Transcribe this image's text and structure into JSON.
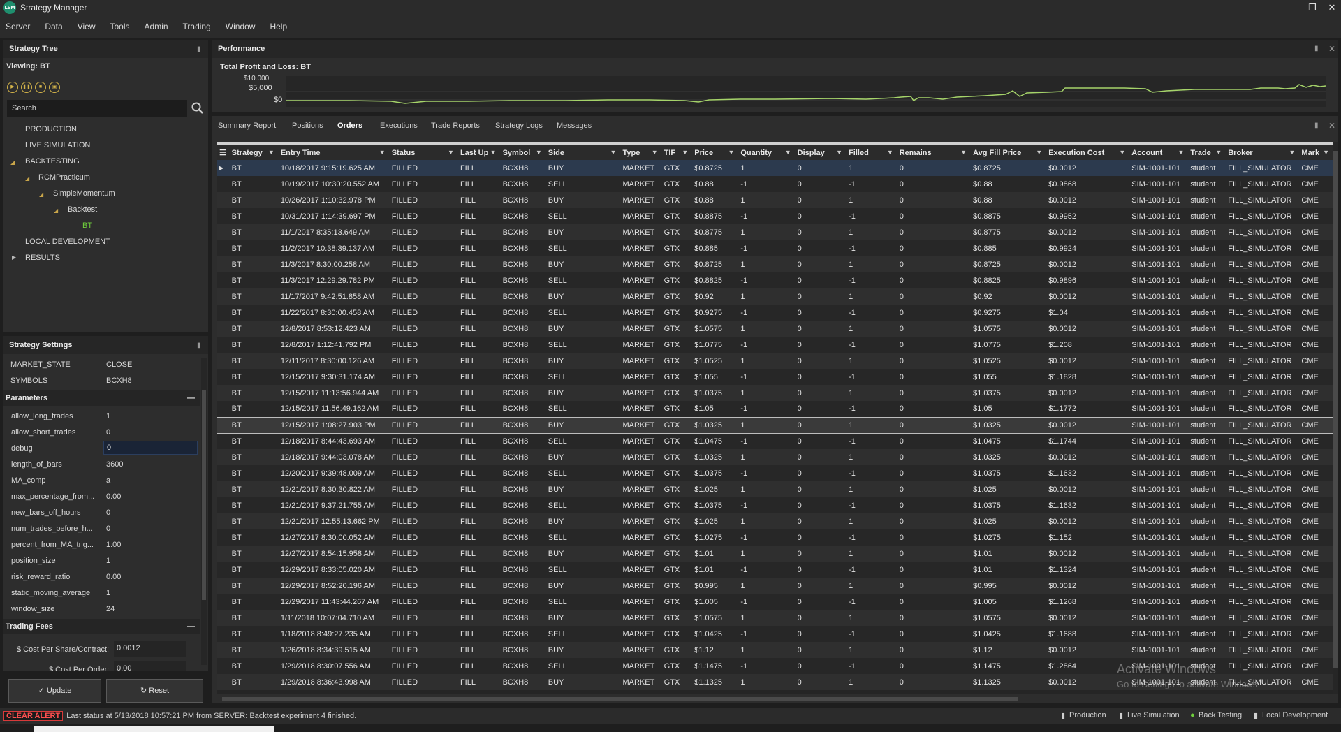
{
  "window": {
    "title": "Strategy Manager",
    "logo": "LSM"
  },
  "menu": [
    "Server",
    "Data",
    "View",
    "Tools",
    "Admin",
    "Trading",
    "Window",
    "Help"
  ],
  "strategy_tree": {
    "title": "Strategy Tree",
    "viewing": "Viewing: BT",
    "search_placeholder": "Search",
    "items": [
      {
        "label": "PRODUCTION"
      },
      {
        "label": "LIVE SIMULATION"
      },
      {
        "label": "BACKTESTING"
      },
      {
        "label": "RCMPracticum"
      },
      {
        "label": "SimpleMomentum"
      },
      {
        "label": "Backtest"
      },
      {
        "label": "BT"
      },
      {
        "label": "LOCAL DEVELOPMENT"
      },
      {
        "label": "RESULTS"
      }
    ]
  },
  "strategy_settings": {
    "title": "Strategy Settings",
    "top_rows": [
      {
        "label": "MARKET_STATE",
        "value": "CLOSE"
      },
      {
        "label": "SYMBOLS",
        "value": "BCXH8"
      }
    ],
    "parameters_title": "Parameters",
    "parameters": [
      {
        "label": "allow_long_trades",
        "value": "1"
      },
      {
        "label": "allow_short_trades",
        "value": "0"
      },
      {
        "label": "debug",
        "value": "0"
      },
      {
        "label": "length_of_bars",
        "value": "3600"
      },
      {
        "label": "MA_comp",
        "value": "a"
      },
      {
        "label": "max_percentage_from...",
        "value": "0.00"
      },
      {
        "label": "new_bars_off_hours",
        "value": "0"
      },
      {
        "label": "num_trades_before_h...",
        "value": "0"
      },
      {
        "label": "percent_from_MA_trig...",
        "value": "1.00"
      },
      {
        "label": "position_size",
        "value": "1"
      },
      {
        "label": "risk_reward_ratio",
        "value": "0.00"
      },
      {
        "label": "static_moving_average",
        "value": "1"
      },
      {
        "label": "window_size",
        "value": "24"
      }
    ],
    "fees_title": "Trading Fees",
    "cost_share_label": "$ Cost Per Share/Contract:",
    "cost_share_value": "0.0012",
    "cost_order_label": "$ Cost Per Order:",
    "cost_order_value": "0.00",
    "update_label": "Update",
    "reset_label": "Reset"
  },
  "performance": {
    "title": "Performance",
    "subtitle": "Total Profit and Loss: BT",
    "y_ticks": [
      "$10,000",
      "$5,000",
      "$0"
    ],
    "line_color": "#a6d46a"
  },
  "orders_panel": {
    "tabs": [
      "Summary Report",
      "Positions",
      "Orders",
      "Executions",
      "Trade Reports",
      "Strategy Logs",
      "Messages"
    ],
    "active_tab": "Orders",
    "columns": [
      "Strategy",
      "Entry Time",
      "Status",
      "Last Up",
      "Symbol",
      "Side",
      "Type",
      "TIF",
      "Price",
      "Quantity",
      "Display",
      "Filled",
      "Remains",
      "Avg Fill Price",
      "Execution Cost",
      "Account",
      "Trade",
      "Broker",
      "Mark"
    ],
    "rows": [
      [
        "BT",
        "10/18/2017 9:15:19.625 AM",
        "FILLED",
        "FILL",
        "BCXH8",
        "BUY",
        "MARKET",
        "GTX",
        "$0.8725",
        "1",
        "0",
        "1",
        "0",
        "$0.8725",
        "$0.0012",
        "SIM-1001-101",
        "student",
        "FILL_SIMULATOR",
        "CME"
      ],
      [
        "BT",
        "10/19/2017 10:30:20.552 AM",
        "FILLED",
        "FILL",
        "BCXH8",
        "SELL",
        "MARKET",
        "GTX",
        "$0.88",
        "-1",
        "0",
        "-1",
        "0",
        "$0.88",
        "$0.9868",
        "SIM-1001-101",
        "student",
        "FILL_SIMULATOR",
        "CME"
      ],
      [
        "BT",
        "10/26/2017 1:10:32.978 PM",
        "FILLED",
        "FILL",
        "BCXH8",
        "BUY",
        "MARKET",
        "GTX",
        "$0.88",
        "1",
        "0",
        "1",
        "0",
        "$0.88",
        "$0.0012",
        "SIM-1001-101",
        "student",
        "FILL_SIMULATOR",
        "CME"
      ],
      [
        "BT",
        "10/31/2017 1:14:39.697 PM",
        "FILLED",
        "FILL",
        "BCXH8",
        "SELL",
        "MARKET",
        "GTX",
        "$0.8875",
        "-1",
        "0",
        "-1",
        "0",
        "$0.8875",
        "$0.9952",
        "SIM-1001-101",
        "student",
        "FILL_SIMULATOR",
        "CME"
      ],
      [
        "BT",
        "11/1/2017 8:35:13.649 AM",
        "FILLED",
        "FILL",
        "BCXH8",
        "BUY",
        "MARKET",
        "GTX",
        "$0.8775",
        "1",
        "0",
        "1",
        "0",
        "$0.8775",
        "$0.0012",
        "SIM-1001-101",
        "student",
        "FILL_SIMULATOR",
        "CME"
      ],
      [
        "BT",
        "11/2/2017 10:38:39.137 AM",
        "FILLED",
        "FILL",
        "BCXH8",
        "SELL",
        "MARKET",
        "GTX",
        "$0.885",
        "-1",
        "0",
        "-1",
        "0",
        "$0.885",
        "$0.9924",
        "SIM-1001-101",
        "student",
        "FILL_SIMULATOR",
        "CME"
      ],
      [
        "BT",
        "11/3/2017 8:30:00.258 AM",
        "FILLED",
        "FILL",
        "BCXH8",
        "BUY",
        "MARKET",
        "GTX",
        "$0.8725",
        "1",
        "0",
        "1",
        "0",
        "$0.8725",
        "$0.0012",
        "SIM-1001-101",
        "student",
        "FILL_SIMULATOR",
        "CME"
      ],
      [
        "BT",
        "11/3/2017 12:29:29.782 PM",
        "FILLED",
        "FILL",
        "BCXH8",
        "SELL",
        "MARKET",
        "GTX",
        "$0.8825",
        "-1",
        "0",
        "-1",
        "0",
        "$0.8825",
        "$0.9896",
        "SIM-1001-101",
        "student",
        "FILL_SIMULATOR",
        "CME"
      ],
      [
        "BT",
        "11/17/2017 9:42:51.858 AM",
        "FILLED",
        "FILL",
        "BCXH8",
        "BUY",
        "MARKET",
        "GTX",
        "$0.92",
        "1",
        "0",
        "1",
        "0",
        "$0.92",
        "$0.0012",
        "SIM-1001-101",
        "student",
        "FILL_SIMULATOR",
        "CME"
      ],
      [
        "BT",
        "11/22/2017 8:30:00.458 AM",
        "FILLED",
        "FILL",
        "BCXH8",
        "SELL",
        "MARKET",
        "GTX",
        "$0.9275",
        "-1",
        "0",
        "-1",
        "0",
        "$0.9275",
        "$1.04",
        "SIM-1001-101",
        "student",
        "FILL_SIMULATOR",
        "CME"
      ],
      [
        "BT",
        "12/8/2017 8:53:12.423 AM",
        "FILLED",
        "FILL",
        "BCXH8",
        "BUY",
        "MARKET",
        "GTX",
        "$1.0575",
        "1",
        "0",
        "1",
        "0",
        "$1.0575",
        "$0.0012",
        "SIM-1001-101",
        "student",
        "FILL_SIMULATOR",
        "CME"
      ],
      [
        "BT",
        "12/8/2017 1:12:41.792 PM",
        "FILLED",
        "FILL",
        "BCXH8",
        "SELL",
        "MARKET",
        "GTX",
        "$1.0775",
        "-1",
        "0",
        "-1",
        "0",
        "$1.0775",
        "$1.208",
        "SIM-1001-101",
        "student",
        "FILL_SIMULATOR",
        "CME"
      ],
      [
        "BT",
        "12/11/2017 8:30:00.126 AM",
        "FILLED",
        "FILL",
        "BCXH8",
        "BUY",
        "MARKET",
        "GTX",
        "$1.0525",
        "1",
        "0",
        "1",
        "0",
        "$1.0525",
        "$0.0012",
        "SIM-1001-101",
        "student",
        "FILL_SIMULATOR",
        "CME"
      ],
      [
        "BT",
        "12/15/2017 9:30:31.174 AM",
        "FILLED",
        "FILL",
        "BCXH8",
        "SELL",
        "MARKET",
        "GTX",
        "$1.055",
        "-1",
        "0",
        "-1",
        "0",
        "$1.055",
        "$1.1828",
        "SIM-1001-101",
        "student",
        "FILL_SIMULATOR",
        "CME"
      ],
      [
        "BT",
        "12/15/2017 11:13:56.944 AM",
        "FILLED",
        "FILL",
        "BCXH8",
        "BUY",
        "MARKET",
        "GTX",
        "$1.0375",
        "1",
        "0",
        "1",
        "0",
        "$1.0375",
        "$0.0012",
        "SIM-1001-101",
        "student",
        "FILL_SIMULATOR",
        "CME"
      ],
      [
        "BT",
        "12/15/2017 11:56:49.162 AM",
        "FILLED",
        "FILL",
        "BCXH8",
        "SELL",
        "MARKET",
        "GTX",
        "$1.05",
        "-1",
        "0",
        "-1",
        "0",
        "$1.05",
        "$1.1772",
        "SIM-1001-101",
        "student",
        "FILL_SIMULATOR",
        "CME"
      ],
      [
        "BT",
        "12/15/2017 1:08:27.903 PM",
        "FILLED",
        "FILL",
        "BCXH8",
        "BUY",
        "MARKET",
        "GTX",
        "$1.0325",
        "1",
        "0",
        "1",
        "0",
        "$1.0325",
        "$0.0012",
        "SIM-1001-101",
        "student",
        "FILL_SIMULATOR",
        "CME"
      ],
      [
        "BT",
        "12/18/2017 8:44:43.693 AM",
        "FILLED",
        "FILL",
        "BCXH8",
        "SELL",
        "MARKET",
        "GTX",
        "$1.0475",
        "-1",
        "0",
        "-1",
        "0",
        "$1.0475",
        "$1.1744",
        "SIM-1001-101",
        "student",
        "FILL_SIMULATOR",
        "CME"
      ],
      [
        "BT",
        "12/18/2017 9:44:03.078 AM",
        "FILLED",
        "FILL",
        "BCXH8",
        "BUY",
        "MARKET",
        "GTX",
        "$1.0325",
        "1",
        "0",
        "1",
        "0",
        "$1.0325",
        "$0.0012",
        "SIM-1001-101",
        "student",
        "FILL_SIMULATOR",
        "CME"
      ],
      [
        "BT",
        "12/20/2017 9:39:48.009 AM",
        "FILLED",
        "FILL",
        "BCXH8",
        "SELL",
        "MARKET",
        "GTX",
        "$1.0375",
        "-1",
        "0",
        "-1",
        "0",
        "$1.0375",
        "$1.1632",
        "SIM-1001-101",
        "student",
        "FILL_SIMULATOR",
        "CME"
      ],
      [
        "BT",
        "12/21/2017 8:30:30.822 AM",
        "FILLED",
        "FILL",
        "BCXH8",
        "BUY",
        "MARKET",
        "GTX",
        "$1.025",
        "1",
        "0",
        "1",
        "0",
        "$1.025",
        "$0.0012",
        "SIM-1001-101",
        "student",
        "FILL_SIMULATOR",
        "CME"
      ],
      [
        "BT",
        "12/21/2017 9:37:21.755 AM",
        "FILLED",
        "FILL",
        "BCXH8",
        "SELL",
        "MARKET",
        "GTX",
        "$1.0375",
        "-1",
        "0",
        "-1",
        "0",
        "$1.0375",
        "$1.1632",
        "SIM-1001-101",
        "student",
        "FILL_SIMULATOR",
        "CME"
      ],
      [
        "BT",
        "12/21/2017 12:55:13.662 PM",
        "FILLED",
        "FILL",
        "BCXH8",
        "BUY",
        "MARKET",
        "GTX",
        "$1.025",
        "1",
        "0",
        "1",
        "0",
        "$1.025",
        "$0.0012",
        "SIM-1001-101",
        "student",
        "FILL_SIMULATOR",
        "CME"
      ],
      [
        "BT",
        "12/27/2017 8:30:00.052 AM",
        "FILLED",
        "FILL",
        "BCXH8",
        "SELL",
        "MARKET",
        "GTX",
        "$1.0275",
        "-1",
        "0",
        "-1",
        "0",
        "$1.0275",
        "$1.152",
        "SIM-1001-101",
        "student",
        "FILL_SIMULATOR",
        "CME"
      ],
      [
        "BT",
        "12/27/2017 8:54:15.958 AM",
        "FILLED",
        "FILL",
        "BCXH8",
        "BUY",
        "MARKET",
        "GTX",
        "$1.01",
        "1",
        "0",
        "1",
        "0",
        "$1.01",
        "$0.0012",
        "SIM-1001-101",
        "student",
        "FILL_SIMULATOR",
        "CME"
      ],
      [
        "BT",
        "12/29/2017 8:33:05.020 AM",
        "FILLED",
        "FILL",
        "BCXH8",
        "SELL",
        "MARKET",
        "GTX",
        "$1.01",
        "-1",
        "0",
        "-1",
        "0",
        "$1.01",
        "$1.1324",
        "SIM-1001-101",
        "student",
        "FILL_SIMULATOR",
        "CME"
      ],
      [
        "BT",
        "12/29/2017 8:52:20.196 AM",
        "FILLED",
        "FILL",
        "BCXH8",
        "BUY",
        "MARKET",
        "GTX",
        "$0.995",
        "1",
        "0",
        "1",
        "0",
        "$0.995",
        "$0.0012",
        "SIM-1001-101",
        "student",
        "FILL_SIMULATOR",
        "CME"
      ],
      [
        "BT",
        "12/29/2017 11:43:44.267 AM",
        "FILLED",
        "FILL",
        "BCXH8",
        "SELL",
        "MARKET",
        "GTX",
        "$1.005",
        "-1",
        "0",
        "-1",
        "0",
        "$1.005",
        "$1.1268",
        "SIM-1001-101",
        "student",
        "FILL_SIMULATOR",
        "CME"
      ],
      [
        "BT",
        "1/11/2018 10:07:04.710 AM",
        "FILLED",
        "FILL",
        "BCXH8",
        "BUY",
        "MARKET",
        "GTX",
        "$1.0575",
        "1",
        "0",
        "1",
        "0",
        "$1.0575",
        "$0.0012",
        "SIM-1001-101",
        "student",
        "FILL_SIMULATOR",
        "CME"
      ],
      [
        "BT",
        "1/18/2018 8:49:27.235 AM",
        "FILLED",
        "FILL",
        "BCXH8",
        "SELL",
        "MARKET",
        "GTX",
        "$1.0425",
        "-1",
        "0",
        "-1",
        "0",
        "$1.0425",
        "$1.1688",
        "SIM-1001-101",
        "student",
        "FILL_SIMULATOR",
        "CME"
      ],
      [
        "BT",
        "1/26/2018 8:34:39.515 AM",
        "FILLED",
        "FILL",
        "BCXH8",
        "BUY",
        "MARKET",
        "GTX",
        "$1.12",
        "1",
        "0",
        "1",
        "0",
        "$1.12",
        "$0.0012",
        "SIM-1001-101",
        "student",
        "FILL_SIMULATOR",
        "CME"
      ],
      [
        "BT",
        "1/29/2018 8:30:07.556 AM",
        "FILLED",
        "FILL",
        "BCXH8",
        "SELL",
        "MARKET",
        "GTX",
        "$1.1475",
        "-1",
        "0",
        "-1",
        "0",
        "$1.1475",
        "$1.2864",
        "SIM-1001-101",
        "student",
        "FILL_SIMULATOR",
        "CME"
      ],
      [
        "BT",
        "1/29/2018 8:36:43.998 AM",
        "FILLED",
        "FILL",
        "BCXH8",
        "BUY",
        "MARKET",
        "GTX",
        "$1.1325",
        "1",
        "0",
        "1",
        "0",
        "$1.1325",
        "$0.0012",
        "SIM-1001-101",
        "student",
        "FILL_SIMULATOR",
        "CME"
      ]
    ]
  },
  "status_bar": {
    "clear_alert": "CLEAR ALERT",
    "message": "Last status at 5/13/2018 10:57:21 PM from SERVER: Backtest experiment 4 finished.",
    "modes": [
      "Production",
      "Live Simulation",
      "Back Testing",
      "Local Development"
    ]
  },
  "watermark": {
    "line1": "Activate Windows",
    "line2": "Go to Settings to activate Windows."
  },
  "colors": {
    "alert": "#ff5050",
    "accent": "#d4b44a",
    "selected_row": "#2c3a4e",
    "tree_selected": "#6fcf3c"
  }
}
